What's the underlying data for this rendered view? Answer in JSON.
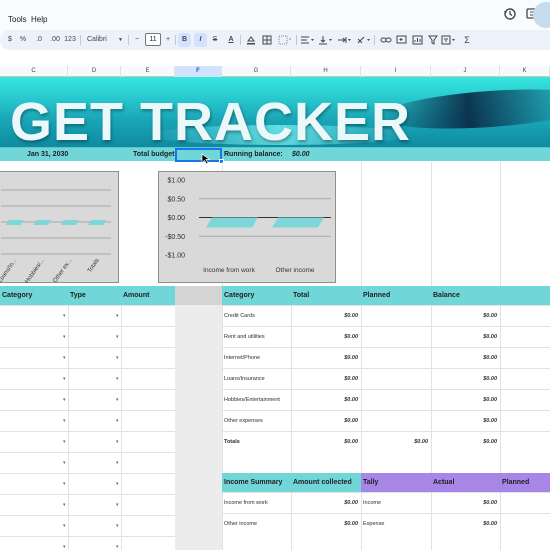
{
  "menu": {
    "items": [
      "Tools",
      "Help"
    ]
  },
  "toolbar": {
    "currency": "$",
    "percent": "%",
    "decrease_decimal": ".0",
    "increase_decimal": ".00",
    "more_formats": "123",
    "font": "Calibri",
    "font_size": "11",
    "minus": "−",
    "plus": "+",
    "bold": "B",
    "italic": "I",
    "strike": "S",
    "text_color": "A",
    "sigma": "Σ"
  },
  "columns": [
    "C",
    "D",
    "E",
    "F",
    "G",
    "H",
    "I",
    "J",
    "K"
  ],
  "selected_column": "F",
  "banner": {
    "title": "GET TRACKER"
  },
  "info_row": {
    "date": "Jan 31, 2030",
    "total_budget_label": "Total budget:",
    "running_balance_label": "Running balance:",
    "running_balance_value": "$0.00"
  },
  "chart_data": [
    {
      "type": "bar",
      "categories": [
        "Loans/In...",
        "Hobbies/...",
        "Other ex...",
        "Totals"
      ],
      "values": [
        0,
        0,
        0,
        0
      ]
    },
    {
      "type": "bar",
      "categories": [
        "Income from work",
        "Other income"
      ],
      "values": [
        0,
        0
      ],
      "yticks": [
        "$1.00",
        "$0.50",
        "$0.00",
        "-$0.50",
        "-$1.00"
      ],
      "ylim": [
        -1,
        1
      ]
    }
  ],
  "left_table": {
    "headers": [
      "Category",
      "Type",
      "Amount"
    ]
  },
  "expense_table": {
    "headers": [
      "Category",
      "Total",
      "Planned",
      "Balance"
    ],
    "rows": [
      {
        "category": "Credit Cards",
        "total": "$0.00",
        "planned": "",
        "balance": "$0.00"
      },
      {
        "category": "Rent and utilities",
        "total": "$0.00",
        "planned": "",
        "balance": "$0.00"
      },
      {
        "category": "Internet/Phone",
        "total": "$0.00",
        "planned": "",
        "balance": "$0.00"
      },
      {
        "category": "Loans/Insurance",
        "total": "$0.00",
        "planned": "",
        "balance": "$0.00"
      },
      {
        "category": "Hobbies/Entertainment",
        "total": "$0.00",
        "planned": "",
        "balance": "$0.00"
      },
      {
        "category": "Other expenses",
        "total": "$0.00",
        "planned": "",
        "balance": "$0.00"
      },
      {
        "category": "Totals",
        "total": "$0.00",
        "planned": "$0.00",
        "balance": "$0.00"
      }
    ]
  },
  "income_table": {
    "headers": [
      "Income Summary",
      "Amount collected",
      "Tally",
      "Actual",
      "Planned"
    ],
    "rows": [
      {
        "category": "Income from work",
        "amount": "$0.00",
        "tally": "Income",
        "actual": "$0.00"
      },
      {
        "category": "Other income",
        "amount": "$0.00",
        "tally": "Expense",
        "actual": "$0.00"
      }
    ]
  },
  "colors": {
    "teal": "#71d6d8",
    "purple": "#a786e8",
    "selection": "#1a73e8"
  }
}
